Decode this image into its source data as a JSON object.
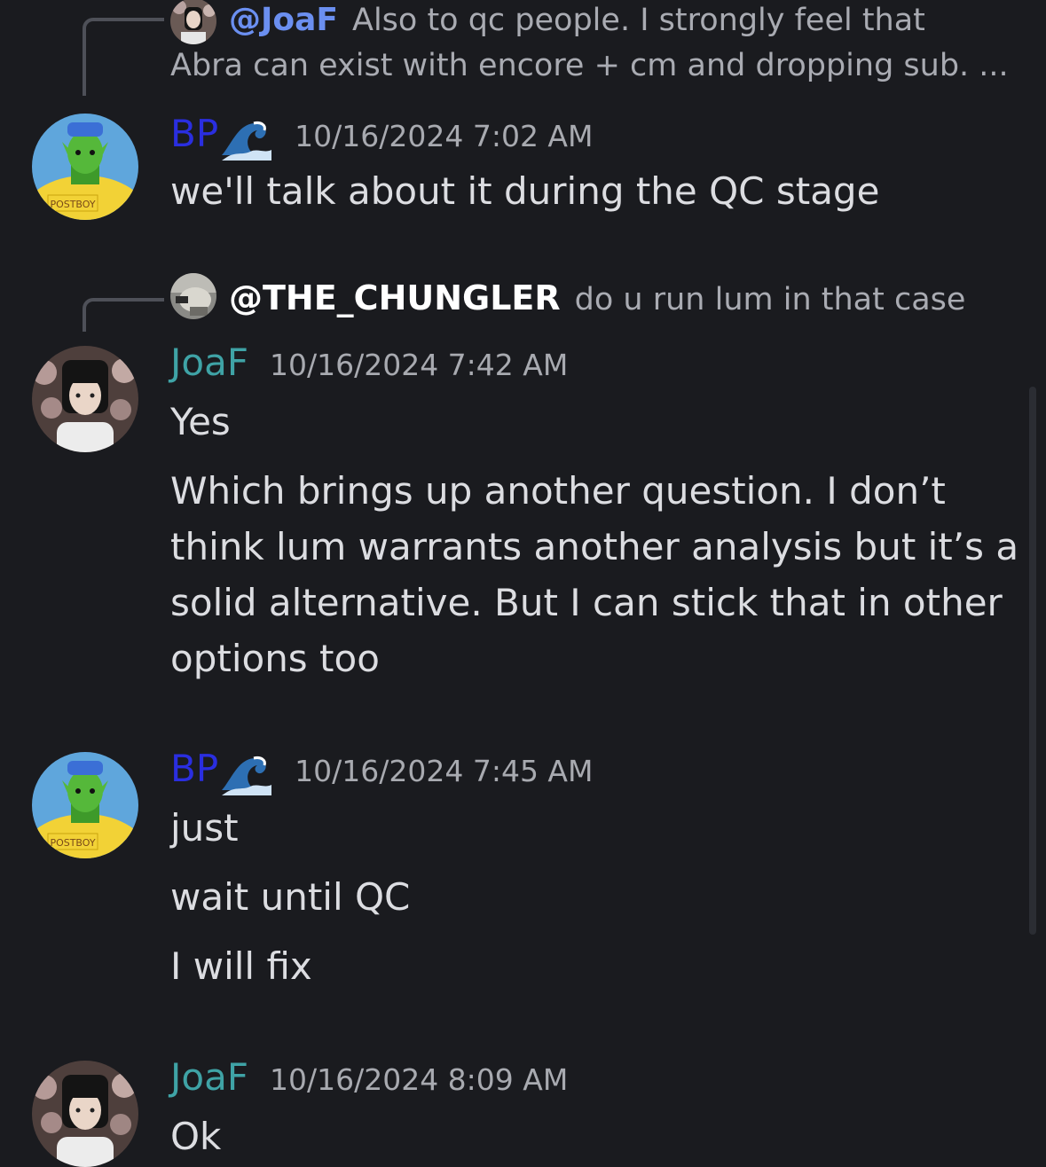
{
  "colors": {
    "background": "#1a1b1f",
    "bp_name": "#2a2ee0",
    "joaf_name": "#3fa3a6",
    "reply_mention": "#6b8ff0",
    "muted_text": "#a8aab0",
    "message_text": "#dcdde1"
  },
  "messages": [
    {
      "reply": {
        "mention": "@JoaF",
        "text_line1": "Also to qc people. I strongly feel that",
        "text_line2": "Abra can exist with encore + cm and dropping sub. ..."
      },
      "author": "BP",
      "has_wave_emoji": true,
      "timestamp": "10/16/2024 7:02 AM",
      "lines": [
        "we'll talk about it during the QC stage"
      ]
    },
    {
      "reply": {
        "mention": "@THE_CHUNGLER",
        "text": "do u run lum in that case"
      },
      "author": "JoaF",
      "timestamp": "10/16/2024 7:42 AM",
      "lines": [
        "Yes",
        "Which brings up another question. I don’t think lum warrants another analysis but it’s a solid alternative. But I can stick that in other options too"
      ]
    },
    {
      "author": "BP",
      "has_wave_emoji": true,
      "timestamp": "10/16/2024 7:45 AM",
      "lines": [
        "just",
        "wait until QC",
        "I will fix"
      ]
    },
    {
      "author": "JoaF",
      "timestamp": "10/16/2024 8:09 AM",
      "lines": [
        "Ok"
      ]
    }
  ],
  "avatars": {
    "bp_badge_text": "POSTBOY"
  }
}
